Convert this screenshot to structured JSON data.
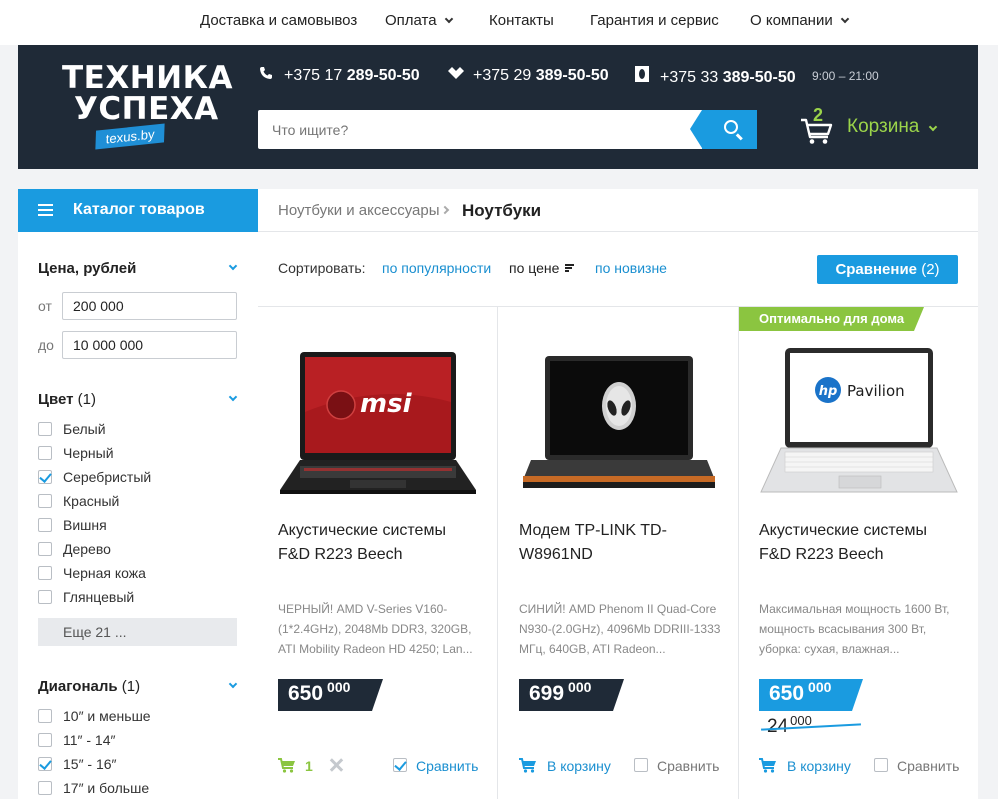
{
  "topnav": {
    "items": [
      {
        "label": "Доставка и самовывоз",
        "dropdown": false
      },
      {
        "label": "Оплата",
        "dropdown": true
      },
      {
        "label": "Контакты",
        "dropdown": false
      },
      {
        "label": "Гарантия и сервис",
        "dropdown": false
      },
      {
        "label": "О компании",
        "dropdown": true
      }
    ]
  },
  "header": {
    "logo_line1": "ТЕХНИКА",
    "logo_line2": "УСПЕХА",
    "logo_badge": "texus.by",
    "phones": [
      {
        "prefix": "+375 17",
        "number": "289-50-50",
        "icon": "phone-icon"
      },
      {
        "prefix": "+375 29",
        "number": "389-50-50",
        "icon": "velcom-icon"
      },
      {
        "prefix": "+375 33",
        "number": "389-50-50",
        "icon": "mts-icon"
      }
    ],
    "hours": "9:00 – 21:00",
    "search_placeholder": "Что ищите?",
    "cart_count": "2",
    "cart_label": "Корзина"
  },
  "colors": {
    "dark": "#1f2a37",
    "accent": "#1a9be0",
    "green": "#8bc540",
    "cart_green": "#9bd44a"
  },
  "sidebar": {
    "catalog_label": "Каталог товаров",
    "price": {
      "title": "Цена, рублей",
      "from_label": "от",
      "from_value": "200 000",
      "to_label": "до",
      "to_value": "10 000 000"
    },
    "color": {
      "title": "Цвет",
      "count": "(1)",
      "options": [
        {
          "label": "Белый",
          "checked": false
        },
        {
          "label": "Черный",
          "checked": false
        },
        {
          "label": "Серебристый",
          "checked": true
        },
        {
          "label": "Красный",
          "checked": false
        },
        {
          "label": "Вишня",
          "checked": false
        },
        {
          "label": "Дерево",
          "checked": false
        },
        {
          "label": "Черная кожа",
          "checked": false
        },
        {
          "label": "Глянцевый",
          "checked": false
        }
      ],
      "more_label": "Еще 21 ..."
    },
    "diagonal": {
      "title": "Диагональ",
      "count": "(1)",
      "options": [
        {
          "label": "10″ и меньше",
          "checked": false
        },
        {
          "label": "11″ - 14″",
          "checked": false
        },
        {
          "label": "15″ - 16″",
          "checked": true
        },
        {
          "label": "17″ и больше",
          "checked": false
        }
      ]
    }
  },
  "breadcrumbs": {
    "parent": "Ноутбуки и аксессуары",
    "current": "Ноутбуки"
  },
  "sort": {
    "label": "Сортировать:",
    "by_popularity": "по популярности",
    "by_price": "по цене",
    "by_newness": "по новизне",
    "compare_label": "Сравнение",
    "compare_count": "(2)"
  },
  "products": [
    {
      "title": "Акустические системы F&D R223 Beech",
      "desc": "ЧЕРНЫЙ! AMD V-Series V160-(1*2.4GHz), 2048Mb DDR3, 320GB, ATI Mobility Radeon HD 4250; Lan...",
      "price_main": "650",
      "price_small": "000",
      "in_cart_qty": "1",
      "compare_label": "Сравнить",
      "compared": true,
      "image": "msi-laptop",
      "brand_text": "msi"
    },
    {
      "title": "Модем TP-LINK TD-W8961ND",
      "desc": "СИНИЙ! AMD Phenom II Quad-Core N930-(2.0GHz), 4096Mb DDRIII-1333 МГц, 640GB, ATI Radeon...",
      "price_main": "699",
      "price_small": "000",
      "cart_label": "В корзину",
      "compare_label": "Сравнить",
      "compared": false,
      "image": "alienware-laptop"
    },
    {
      "badge": "Оптимально для дома",
      "title": "Акустические системы F&D R223 Beech",
      "desc": "Максимальная мощность 1600 Вт, мощность всасывания 300 Вт, уборка: сухая, влажная...",
      "price_main": "650",
      "price_small": "000",
      "old_price_main": "24",
      "old_price_small": "000",
      "cart_label": "В корзину",
      "compare_label": "Сравнить",
      "compared": false,
      "image": "hp-pavilion-laptop",
      "brand_text": "Pavilion"
    }
  ]
}
